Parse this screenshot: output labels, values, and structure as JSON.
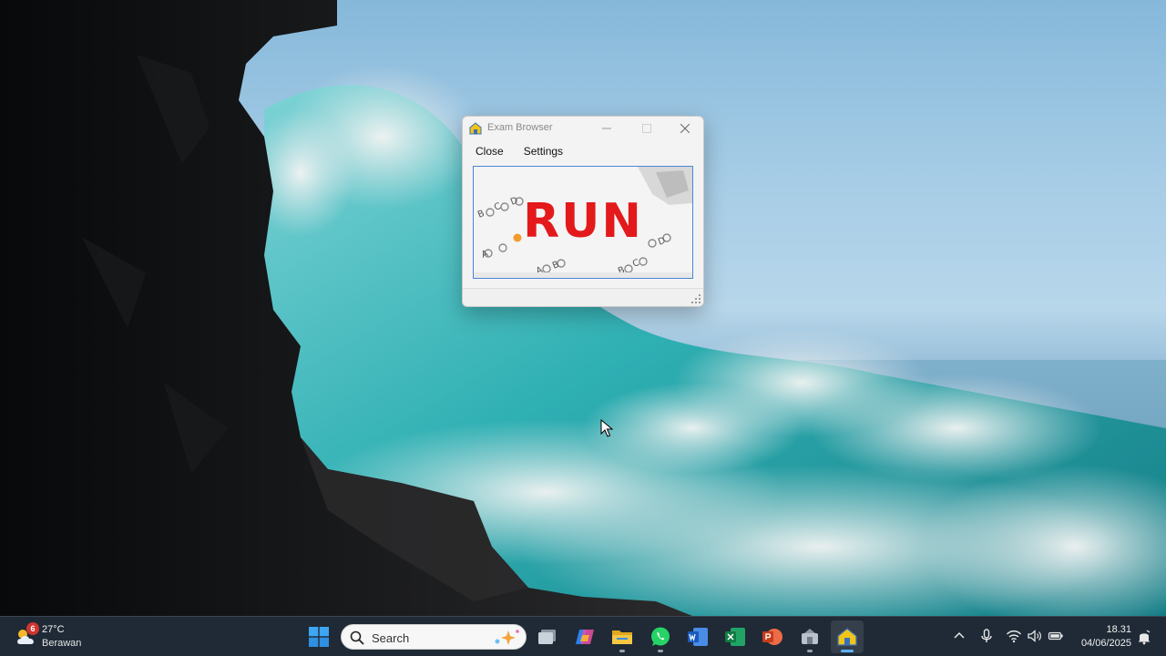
{
  "window": {
    "title": "Exam Browser",
    "menu": [
      "Close",
      "Settings"
    ],
    "banner_text": "RUN"
  },
  "taskbar": {
    "weather": {
      "temperature": "27°C",
      "condition": "Berawan",
      "badge": "6"
    },
    "search": {
      "placeholder": "Search"
    },
    "apps": [
      "windows-start",
      "task-view",
      "copilot",
      "file-explorer",
      "whatsapp",
      "word",
      "excel",
      "powerpoint",
      "exam-app",
      "exam-browser"
    ],
    "clock": {
      "time": "18.31",
      "date": "04/06/2025"
    }
  },
  "colors": {
    "taskbar": "#1f2a36",
    "banner_text": "#e3191b",
    "accent": "#5cb1ff"
  }
}
